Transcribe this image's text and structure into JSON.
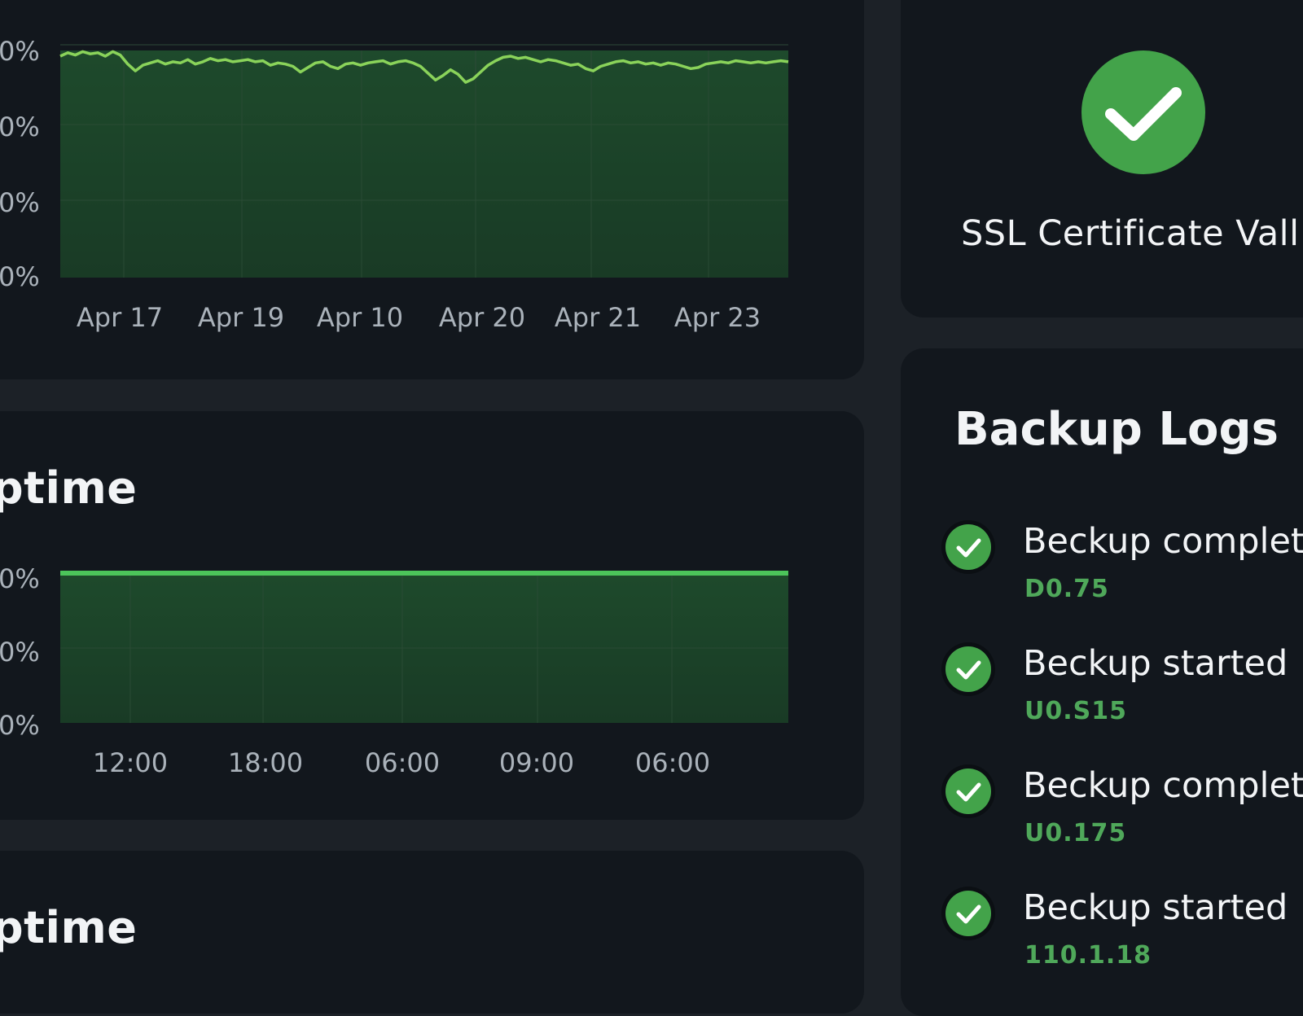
{
  "colors": {
    "background": "#1c2127",
    "card": "#12171d",
    "accent_green": "#43a34a",
    "line_green": "#8ad35a",
    "line_green_flat": "#4cc45a",
    "area_fill": "#1a3a25",
    "tick_text": "#aab2ba"
  },
  "panels": {
    "chart2_title": "ptime",
    "chart3_title": "ptime"
  },
  "ssl": {
    "icon": "check-circle-icon",
    "text": "SSL Certificate Vall"
  },
  "backup": {
    "title": "Backup Logs",
    "items": [
      {
        "icon": "check-circle-icon",
        "label": "Beckup complete",
        "value": "D0.75"
      },
      {
        "icon": "check-circle-icon",
        "label": "Beckup started",
        "value": "U0.S15"
      },
      {
        "icon": "check-circle-icon",
        "label": "Beckup complete",
        "value": "U0.175"
      },
      {
        "icon": "check-circle-icon",
        "label": "Beckup started",
        "value": "110.1.18"
      }
    ]
  },
  "chart_data": [
    {
      "type": "area",
      "title": "",
      "xlabel": "",
      "ylabel": "",
      "y_ticks": [
        "0%",
        "0%",
        "0%",
        "0%"
      ],
      "x_ticks": [
        "Apr 17",
        "Apr 19",
        "Apr 10",
        "Apr 20",
        "Apr 21",
        "Apr 23"
      ],
      "grid": true,
      "series": [
        {
          "values": [
            99.5,
            99.8,
            99.6,
            99.9,
            99.7,
            99.8,
            99.5,
            99.9,
            99.6,
            98.8,
            98.2,
            98.7,
            98.9,
            99.1,
            98.8,
            99.0,
            98.9,
            99.2,
            98.8,
            99.0,
            99.3,
            99.1,
            99.2,
            99.0,
            99.1,
            99.2,
            99.0,
            99.1,
            98.7,
            98.9,
            98.8,
            98.6,
            98.1,
            98.5,
            98.9,
            99.0,
            98.6,
            98.4,
            98.8,
            98.9,
            98.7,
            98.9,
            99.0,
            99.1,
            98.8,
            99.0,
            99.1,
            98.9,
            98.6,
            98.0,
            97.4,
            97.8,
            98.3,
            97.9,
            97.2,
            97.5,
            98.1,
            98.7,
            99.1,
            99.4,
            99.5,
            99.3,
            99.4,
            99.2,
            99.0,
            99.2,
            99.1,
            98.9,
            98.7,
            98.8,
            98.4,
            98.2,
            98.6,
            98.8,
            99.0,
            99.1,
            98.9,
            99.0,
            98.8,
            98.9,
            98.7,
            98.9,
            98.8,
            98.6,
            98.4,
            98.5,
            98.8,
            98.9,
            99.0,
            98.9,
            99.1,
            99.0,
            98.9,
            99.0,
            98.9,
            99.0,
            99.1,
            99.0
          ]
        }
      ]
    },
    {
      "type": "area",
      "title": "",
      "xlabel": "",
      "ylabel": "",
      "y_ticks": [
        "0%",
        "0%",
        "0%"
      ],
      "x_ticks": [
        "12:00",
        "18:00",
        "06:00",
        "09:00",
        "06:00"
      ],
      "grid": true,
      "series": [
        {
          "values": [
            100,
            100
          ]
        }
      ]
    }
  ]
}
